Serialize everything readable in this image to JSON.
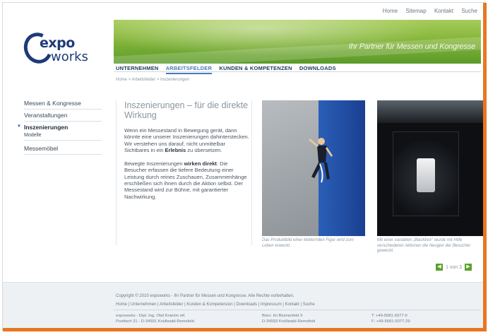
{
  "top_nav": [
    "Home",
    "Sitemap",
    "Kontakt",
    "Suche"
  ],
  "logo": {
    "word1": "expo",
    "word2": "works"
  },
  "banner": {
    "tagline": "Ihr Partner für Messen und Kongresse"
  },
  "main_nav": [
    "UNTERNEHMEN",
    "ARBEITSFELDER",
    "KUNDEN & KOMPETENZEN",
    "DOWNLOADS"
  ],
  "breadcrumb": "Home > Arbeitsfelder > Inszenierungen",
  "sidebar": {
    "items": [
      "Messen & Kongresse",
      "Veranstaltungen",
      "Inszenierungen",
      "Messemöbel"
    ],
    "sub": "Modelle"
  },
  "content": {
    "title": "Inszenierungen – für die direkte Wirkung",
    "p1_a": "Wenn ein Messestand in Bewegung gerät, dann könnte eine unserer Inszenierungen dahinterstecken. Wir verstehen uns darauf, nicht unmittelbar Sichtbares in ein ",
    "p1_b": "Erlebnis",
    "p1_c": " zu übersetzen.",
    "p2_a": "Bewegte Inszenierungen ",
    "p2_b": "wirken direkt",
    "p2_c": ": Die Besucher erfassen die tiefere Bedeutung einer Leistung durch reines Zuschauen, Zusammenhänge erschließen sich ihnen durch die Aktion selbst. Der Messestand wird zur Bühne, mit garantierter Nachwirkung."
  },
  "captions": {
    "photo1": "Das Produktbild einer kletternden Figur wird zum Leben erweckt.",
    "photo2": "Mit einer variablen „Blackbox“ wurde mit Hilfe verschiedener Aktionen die Neugier der Besucher geweckt."
  },
  "pager": {
    "text": "1 von 3",
    "prev": "◀",
    "next": "▶"
  },
  "footer": {
    "copyright": "Copyright © 2010 expoworks - Ihr Partner für Messen und Kongresse. Alle Rechte vorbehalten.",
    "links": "Home | Unternehmen | Arbeitsfelder | Kunden & Kompetenzen | Downloads | Impressum | Kontakt | Suche",
    "addr1_l1": "expoworks - Dipl. Ing. Olaf Knierim eK",
    "addr1_l2": "Postfach 31 - D-34591 Knüllwald-Remsfeld",
    "addr2_l1": "Büro: Im Blumenfeld 9",
    "addr2_l2": "D-34593 Knüllwald-Remsfeld",
    "addr3_l1": "T: +49-5681-9377-0",
    "addr3_l2": "F: +49-5681-9377-29"
  },
  "colors": {
    "accent": "#e87722",
    "brand": "#1e3a78",
    "nav_active": "#4a7ab8",
    "green": "#5aa22a"
  }
}
